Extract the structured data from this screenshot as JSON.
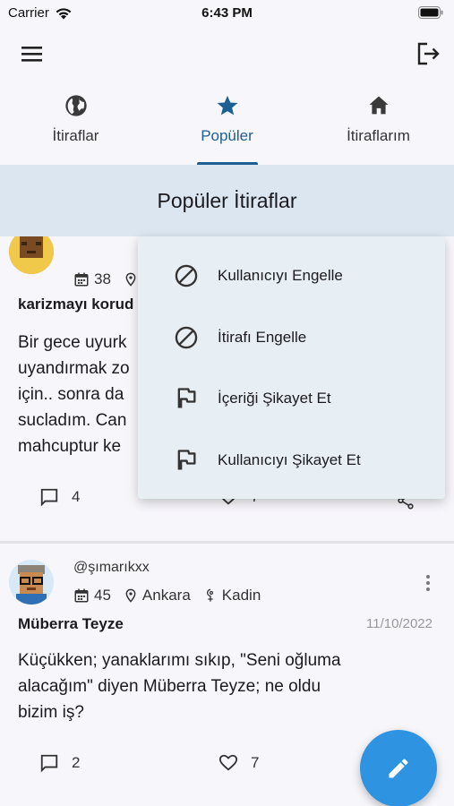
{
  "status_bar": {
    "carrier": "Carrier",
    "time": "6:43 PM"
  },
  "tabs": [
    {
      "label": "İtiraflar",
      "icon": "globe-icon",
      "active": false
    },
    {
      "label": "Popüler",
      "icon": "star-icon",
      "active": true
    },
    {
      "label": "İtiraflarım",
      "icon": "home-icon",
      "active": false
    }
  ],
  "section_title": "Popüler İtiraflar",
  "posts": [
    {
      "age": "38",
      "title": "karizmayı korud",
      "body_lines": [
        "Bir gece uyurk",
        "uyandırmak zo",
        "için.. sonra da",
        "sucladım. Can",
        "mahcuptur ke"
      ],
      "comments": "4",
      "likes": "7"
    },
    {
      "username": "@şımarıkxx",
      "age": "45",
      "city": "Ankara",
      "gender": "Kadin",
      "title": "Müberra Teyze",
      "date": "11/10/2022",
      "body_lines": [
        "Küçükken; yanaklarımı sıkıp, \"Seni oğluma",
        "alacağım\" diyen Müberra Teyze; ne oldu",
        "bizim iş?"
      ],
      "comments": "2",
      "likes": "7"
    }
  ],
  "popup_menu": [
    {
      "label": "Kullanıcıyı Engelle",
      "icon": "block-icon"
    },
    {
      "label": "İtirafı Engelle",
      "icon": "block-icon"
    },
    {
      "label": "İçeriği Şikayet Et",
      "icon": "flag-icon"
    },
    {
      "label": "Kullanıcıyı Şikayet Et",
      "icon": "flag-icon"
    }
  ],
  "colors": {
    "accent": "#1b5f93",
    "fab": "#2e93e0",
    "header_bg": "#dce6f0",
    "popup_bg": "#e7eef4"
  }
}
